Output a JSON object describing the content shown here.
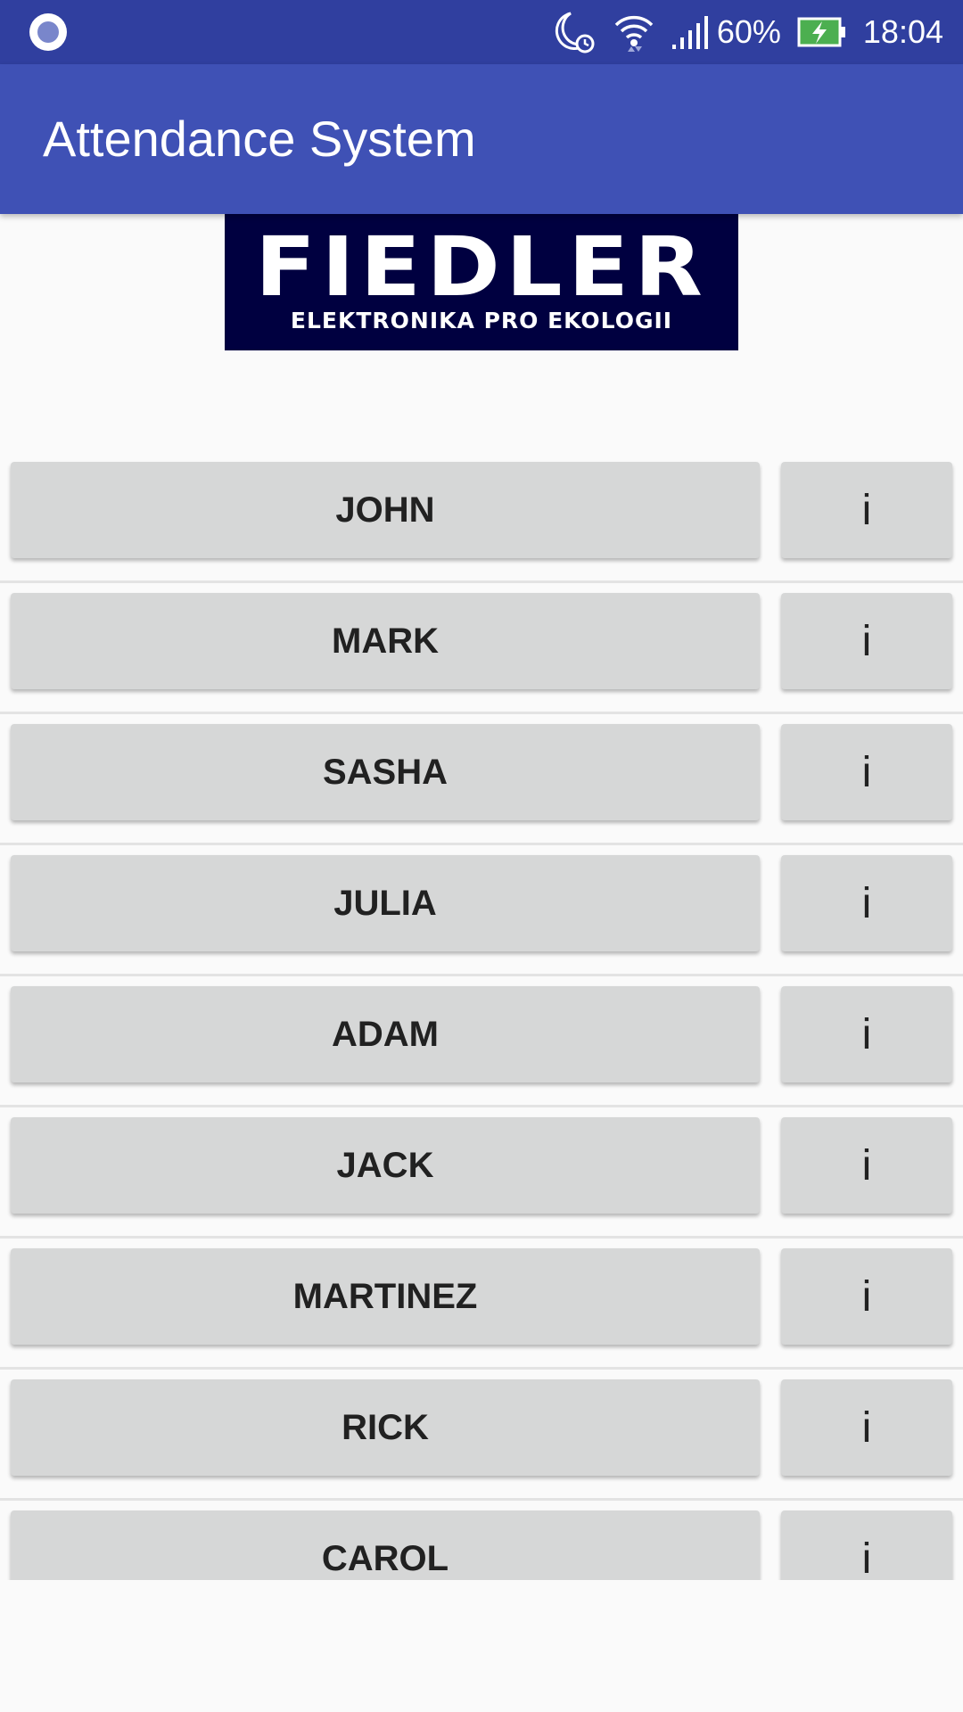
{
  "status_bar": {
    "battery_percent": "60%",
    "time": "18:04",
    "icons": [
      "app-notification-icon",
      "do-not-disturb-alarm-icon",
      "wifi-icon",
      "cellular-signal-icon",
      "battery-charging-icon"
    ]
  },
  "app_bar": {
    "title": "Attendance System"
  },
  "logo": {
    "main_text": "FIEDLER",
    "sub_text": "ELEKTRONIKA PRO EKOLOGII"
  },
  "people": [
    {
      "name": "JOHN",
      "info_label": "i"
    },
    {
      "name": "MARK",
      "info_label": "i"
    },
    {
      "name": "SASHA",
      "info_label": "i"
    },
    {
      "name": "JULIA",
      "info_label": "i"
    },
    {
      "name": "ADAM",
      "info_label": "i"
    },
    {
      "name": "JACK",
      "info_label": "i"
    },
    {
      "name": "MARTINEZ",
      "info_label": "i"
    },
    {
      "name": "RICK",
      "info_label": "i"
    },
    {
      "name": "CAROL",
      "info_label": "i"
    }
  ],
  "colors": {
    "status_bar": "#303f9f",
    "app_bar": "#3f51b5",
    "button": "#d6d7d7",
    "logo_background": "#000040",
    "battery_fill": "#4caf50"
  }
}
